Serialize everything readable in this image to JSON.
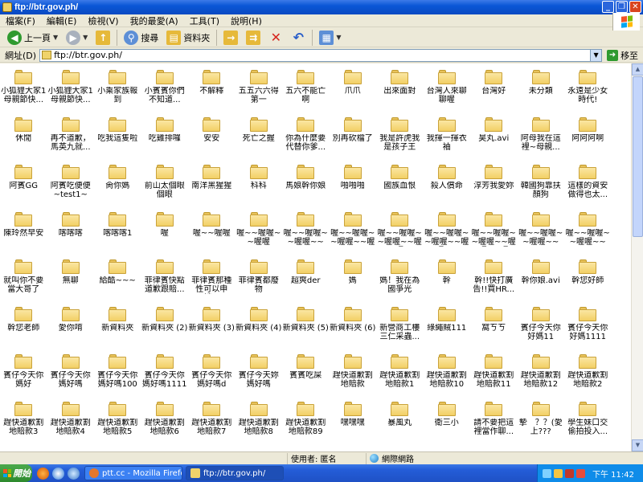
{
  "window": {
    "title": "ftp://btr.gov.ph/"
  },
  "menu": [
    "檔案(F)",
    "編輯(E)",
    "檢視(V)",
    "我的最愛(A)",
    "工具(T)",
    "說明(H)"
  ],
  "toolbar": {
    "back": "上一頁",
    "search": "搜尋",
    "folders": "資料夾"
  },
  "address": {
    "label": "網址(D)",
    "value": "ftp://btr.gov.ph/",
    "go": "移至"
  },
  "folders": [
    "小狐貍大家1母親節快...",
    "小狐貍大家1母親節快...",
    "小乘家族報到",
    "小賓賓你們不知道...",
    "不解釋",
    "五五六六得第一",
    "五六不能亡啊",
    "爪爪",
    "出來面對",
    "台灣人來聊聊喔",
    "台灣好",
    "未分類",
    "永遠是少女時代!",
    "休閒",
    "再不道歉，馬英九就...",
    "吃我這隻啦",
    "吃雞排囉",
    "安安",
    "死亡之握",
    "你為什麼要代替你爹...",
    "別再砍檔了",
    "我是許虎我是孩子王",
    "我揮一揮衣袖",
    "昊丸.avi",
    "阿母我在這裡~母親...",
    "阿阿阿啊",
    "阿賓GG",
    "阿賓吃便便~test1~",
    "肏你媽",
    "前山太個眼個眼",
    "南洋黑猩猩",
    "科科",
    "馬娘幹你娘",
    "啪啪啪",
    "國族血恨",
    "殺人償命",
    "淳芳我愛妳",
    "韓國狗靠扶顏狗",
    "這樣的資安做得也太...",
    "陳玲然早安",
    "喀喀喀",
    "喀喀喀1",
    "喔",
    "喔~~喔喔",
    "喔~~喔喔~~喔喔",
    "喔~~喔喔~~喔喔~~",
    "喔~~喔喔~~喔喔~~喔",
    "喔~~喔喔~~喔喔~~喔喔",
    "喔~~喔喔~~喔喔~~喔喔~~",
    "喔~~喔喔~~喔喔~~喔喔~~喔",
    "喔~~喔喔~~喔喔~~",
    "喔~~喔喔~~喔喔~~",
    "就叫你不要當大哥了",
    "無聊",
    "給酷~~~",
    "菲律賓快點道歉跟賠...",
    "菲律賓那種性可以申請...",
    "菲律賓都廢物",
    "超爽der",
    "媽",
    "媽！我在為國爭光",
    "幹",
    "幹!!快打廣告!!買HR...",
    "幹你娘.avi",
    "幹您好師",
    "幹您老師",
    "愛你唷",
    "新資料夾",
    "新資料夾 (2)",
    "新資料夾 (3)",
    "新資料夾 (4)",
    "新資料夾 (5)",
    "新資料夾 (6)",
    "新營商工樓三仁采蟲...",
    "綠繩賊111",
    "窩ㄎㄎ",
    "賓仔今天你好媽11",
    "賓仔今天你好媽11111...",
    "賓仔今天你媽好",
    "賓仔今天你媽好嗎",
    "賓仔今天你媽好嗎100",
    "賓仔今天你媽好嗎1111",
    "賓仔今天你媽好嗎d",
    "賓仔今天妳媽好嗎",
    "賓賓吃屎",
    "趕快道歉割地賠款",
    "趕快道歉割地賠款1",
    "趕快道歉割地賠款10",
    "趕快道歉割地賠款11",
    "趕快道歉割地賠款12",
    "趕快道歉割地賠款2",
    "趕快道歉割地賠款3",
    "趕快道歉割地賠款4",
    "趕快道歉割地賠款5",
    "趕快道歉割地賠款6",
    "趕快道歉割地賠款7",
    "趕快道歉割地賠款8",
    "趕快道歉割地賠款89",
    "嘿嘿嘿",
    "暴風丸",
    "衛三小",
    "請不要把這裡當作聊...",
    "摯　？？(愛上???",
    "學生妹口交偷拍投入..."
  ],
  "status": {
    "user": "使用者: 匿名",
    "zone": "網際網路"
  },
  "taskbar": {
    "start": "開始",
    "tasks": [
      "ptt.cc - Mozilla Firefox",
      "ftp://btr.gov.ph/"
    ],
    "clock": "下午 11:42"
  }
}
